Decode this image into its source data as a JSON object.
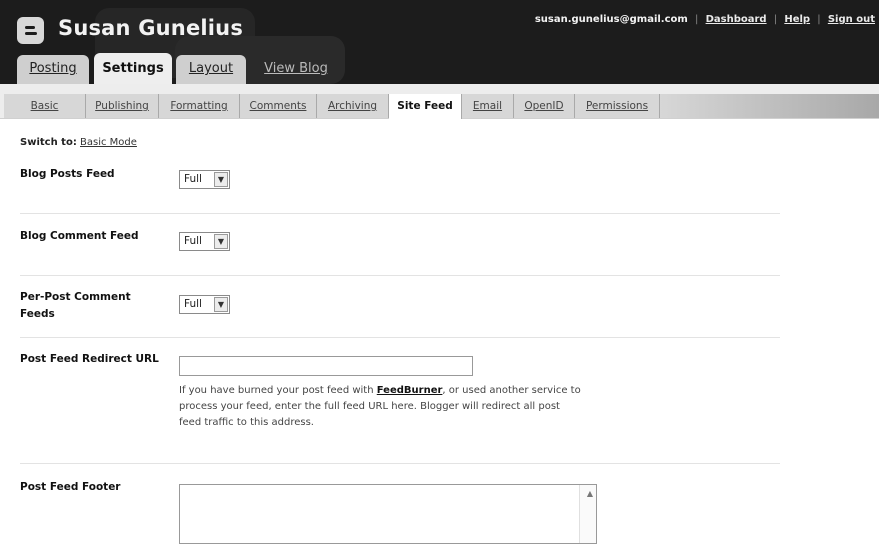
{
  "header": {
    "blog_title": "Susan Gunelius",
    "user_email": "susan.gunelius@gmail.com",
    "links": {
      "dashboard": "Dashboard",
      "help": "Help",
      "sign_out": "Sign out"
    },
    "separator": "|"
  },
  "tabs": {
    "posting": "Posting",
    "settings": "Settings",
    "layout": "Layout",
    "view_blog": "View Blog"
  },
  "subtabs": [
    "Basic",
    "Publishing",
    "Formatting",
    "Comments",
    "Archiving",
    "Site Feed",
    "Email",
    "OpenID",
    "Permissions"
  ],
  "active_subtab": "Site Feed",
  "switch": {
    "label": "Switch to:",
    "link": "Basic Mode"
  },
  "fields": {
    "blog_posts_feed": {
      "label": "Blog Posts Feed",
      "value": "Full"
    },
    "blog_comment_feed": {
      "label": "Blog Comment Feed",
      "value": "Full"
    },
    "per_post_comment_feeds": {
      "label_line1": "Per-Post Comment",
      "label_line2": "Feeds",
      "value": "Full"
    },
    "post_feed_redirect": {
      "label": "Post Feed Redirect URL",
      "value": "",
      "help_prefix": "If you have burned your post feed with ",
      "help_link": "FeedBurner",
      "help_suffix_line1": ", or used another service to",
      "help_line2": "process your feed, enter the full feed URL here. Blogger will redirect all post",
      "help_line3": "feed traffic to this address."
    },
    "post_feed_footer": {
      "label": "Post Feed Footer",
      "value": ""
    }
  },
  "icons": {
    "logo": "blogger-logo-icon",
    "dropdown": "dropdown-arrow-icon"
  },
  "colors": {
    "header_bg": "#1c1c1c",
    "subnav_bg": "#d7d7d7",
    "active_tab_bg": "#eeeeee"
  }
}
